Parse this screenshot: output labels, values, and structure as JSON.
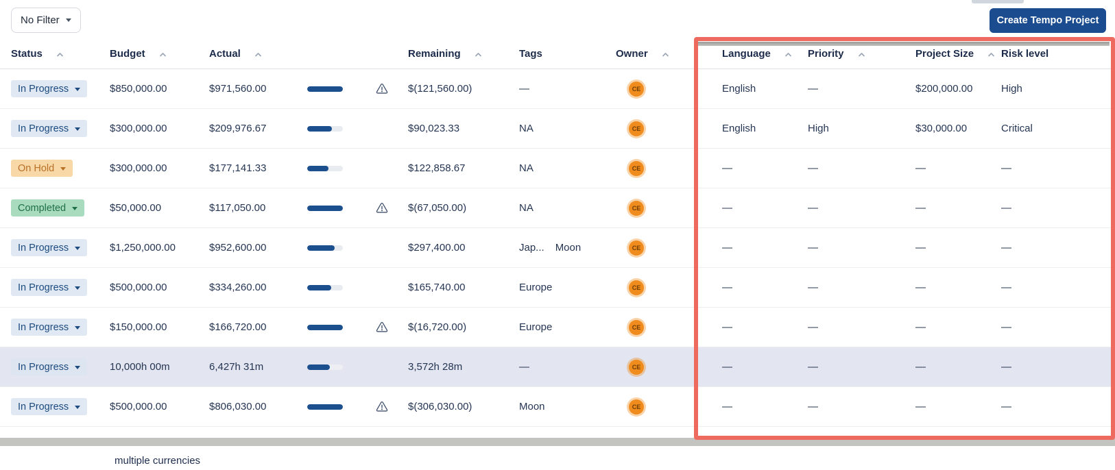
{
  "toolbar": {
    "filter_button": {
      "label": "No Filter"
    },
    "create_button": {
      "label": "Create Tempo Project"
    }
  },
  "table": {
    "headers": [
      {
        "label": "Status",
        "sortable": true
      },
      {
        "label": "Budget",
        "sortable": true
      },
      {
        "label": "Actual",
        "sortable": true
      },
      {
        "label": "",
        "sortable": false
      },
      {
        "label": "Remaining",
        "sortable": true
      },
      {
        "label": "Tags",
        "sortable": false
      },
      {
        "label": "Owner",
        "sortable": true
      },
      {
        "label": "Language",
        "sortable": true
      },
      {
        "label": "Priority",
        "sortable": true
      },
      {
        "label": "Project Size",
        "sortable": true
      },
      {
        "label": "Risk level",
        "sortable": false
      }
    ],
    "rows": [
      {
        "status": "In Progress",
        "status_type": "in-progress",
        "budget": "$850,000.00",
        "actual": "$971,560.00",
        "progress_pct": 100,
        "warning": true,
        "remaining": "$(121,560.00)",
        "tags": [
          "—"
        ],
        "owner_initials": "CE",
        "language": "English",
        "priority": "—",
        "project_size": "$200,000.00",
        "risk_level": "High",
        "highlighted": false
      },
      {
        "status": "In Progress",
        "status_type": "in-progress",
        "budget": "$300,000.00",
        "actual": "$209,976.67",
        "progress_pct": 70,
        "warning": false,
        "remaining": "$90,023.33",
        "tags": [
          "NA"
        ],
        "owner_initials": "CE",
        "language": "English",
        "priority": "High",
        "project_size": "$30,000.00",
        "risk_level": "Critical",
        "highlighted": false
      },
      {
        "status": "On Hold",
        "status_type": "on-hold",
        "budget": "$300,000.00",
        "actual": "$177,141.33",
        "progress_pct": 59,
        "warning": false,
        "remaining": "$122,858.67",
        "tags": [
          "NA"
        ],
        "owner_initials": "CE",
        "language": "—",
        "priority": "—",
        "project_size": "—",
        "risk_level": "—",
        "highlighted": false
      },
      {
        "status": "Completed",
        "status_type": "completed",
        "budget": "$50,000.00",
        "actual": "$117,050.00",
        "progress_pct": 100,
        "warning": true,
        "remaining": "$(67,050.00)",
        "tags": [
          "NA"
        ],
        "owner_initials": "CE",
        "language": "—",
        "priority": "—",
        "project_size": "—",
        "risk_level": "—",
        "highlighted": false
      },
      {
        "status": "In Progress",
        "status_type": "in-progress",
        "budget": "$1,250,000.00",
        "actual": "$952,600.00",
        "progress_pct": 76,
        "warning": false,
        "remaining": "$297,400.00",
        "tags": [
          "Jap...",
          "Moon"
        ],
        "owner_initials": "CE",
        "language": "—",
        "priority": "—",
        "project_size": "—",
        "risk_level": "—",
        "highlighted": false
      },
      {
        "status": "In Progress",
        "status_type": "in-progress",
        "budget": "$500,000.00",
        "actual": "$334,260.00",
        "progress_pct": 67,
        "warning": false,
        "remaining": "$165,740.00",
        "tags": [
          "Europe"
        ],
        "owner_initials": "CE",
        "language": "—",
        "priority": "—",
        "project_size": "—",
        "risk_level": "—",
        "highlighted": false
      },
      {
        "status": "In Progress",
        "status_type": "in-progress",
        "budget": "$150,000.00",
        "actual": "$166,720.00",
        "progress_pct": 100,
        "warning": true,
        "remaining": "$(16,720.00)",
        "tags": [
          "Europe"
        ],
        "owner_initials": "CE",
        "language": "—",
        "priority": "—",
        "project_size": "—",
        "risk_level": "—",
        "highlighted": false
      },
      {
        "status": "In Progress",
        "status_type": "in-progress",
        "budget": "10,000h 00m",
        "actual": "6,427h 31m",
        "progress_pct": 64,
        "warning": false,
        "remaining": "3,572h 28m",
        "tags": [
          "—"
        ],
        "owner_initials": "CE",
        "language": "—",
        "priority": "—",
        "project_size": "—",
        "risk_level": "—",
        "highlighted": true
      },
      {
        "status": "In Progress",
        "status_type": "in-progress",
        "budget": "$500,000.00",
        "actual": "$806,030.00",
        "progress_pct": 100,
        "warning": true,
        "remaining": "$(306,030.00)",
        "tags": [
          "Moon"
        ],
        "owner_initials": "CE",
        "language": "—",
        "priority": "—",
        "project_size": "—",
        "risk_level": "—",
        "highlighted": false
      }
    ]
  },
  "footnote": "multiple currencies",
  "annotation": {
    "type": "highlight-box-around-custom-columns",
    "color": "#ef6a5e"
  },
  "colors": {
    "accent_red": "#ef6a5e",
    "button_navy": "#1b4c8f",
    "progress_bar_navy": "#1c4f8e",
    "avatar_orange": "#ef8c1d",
    "badge_in_progress_bg": "#dfe8f3",
    "badge_on_hold_bg": "#f8d8a7",
    "badge_completed_bg": "#a9dcbe",
    "highlighted_row_bg": "#e3e5f1"
  },
  "icons": {
    "filter_caret": "triangle-down",
    "sort": "chevron-up",
    "status_caret": "triangle-down",
    "over_budget": "warning-triangle"
  }
}
